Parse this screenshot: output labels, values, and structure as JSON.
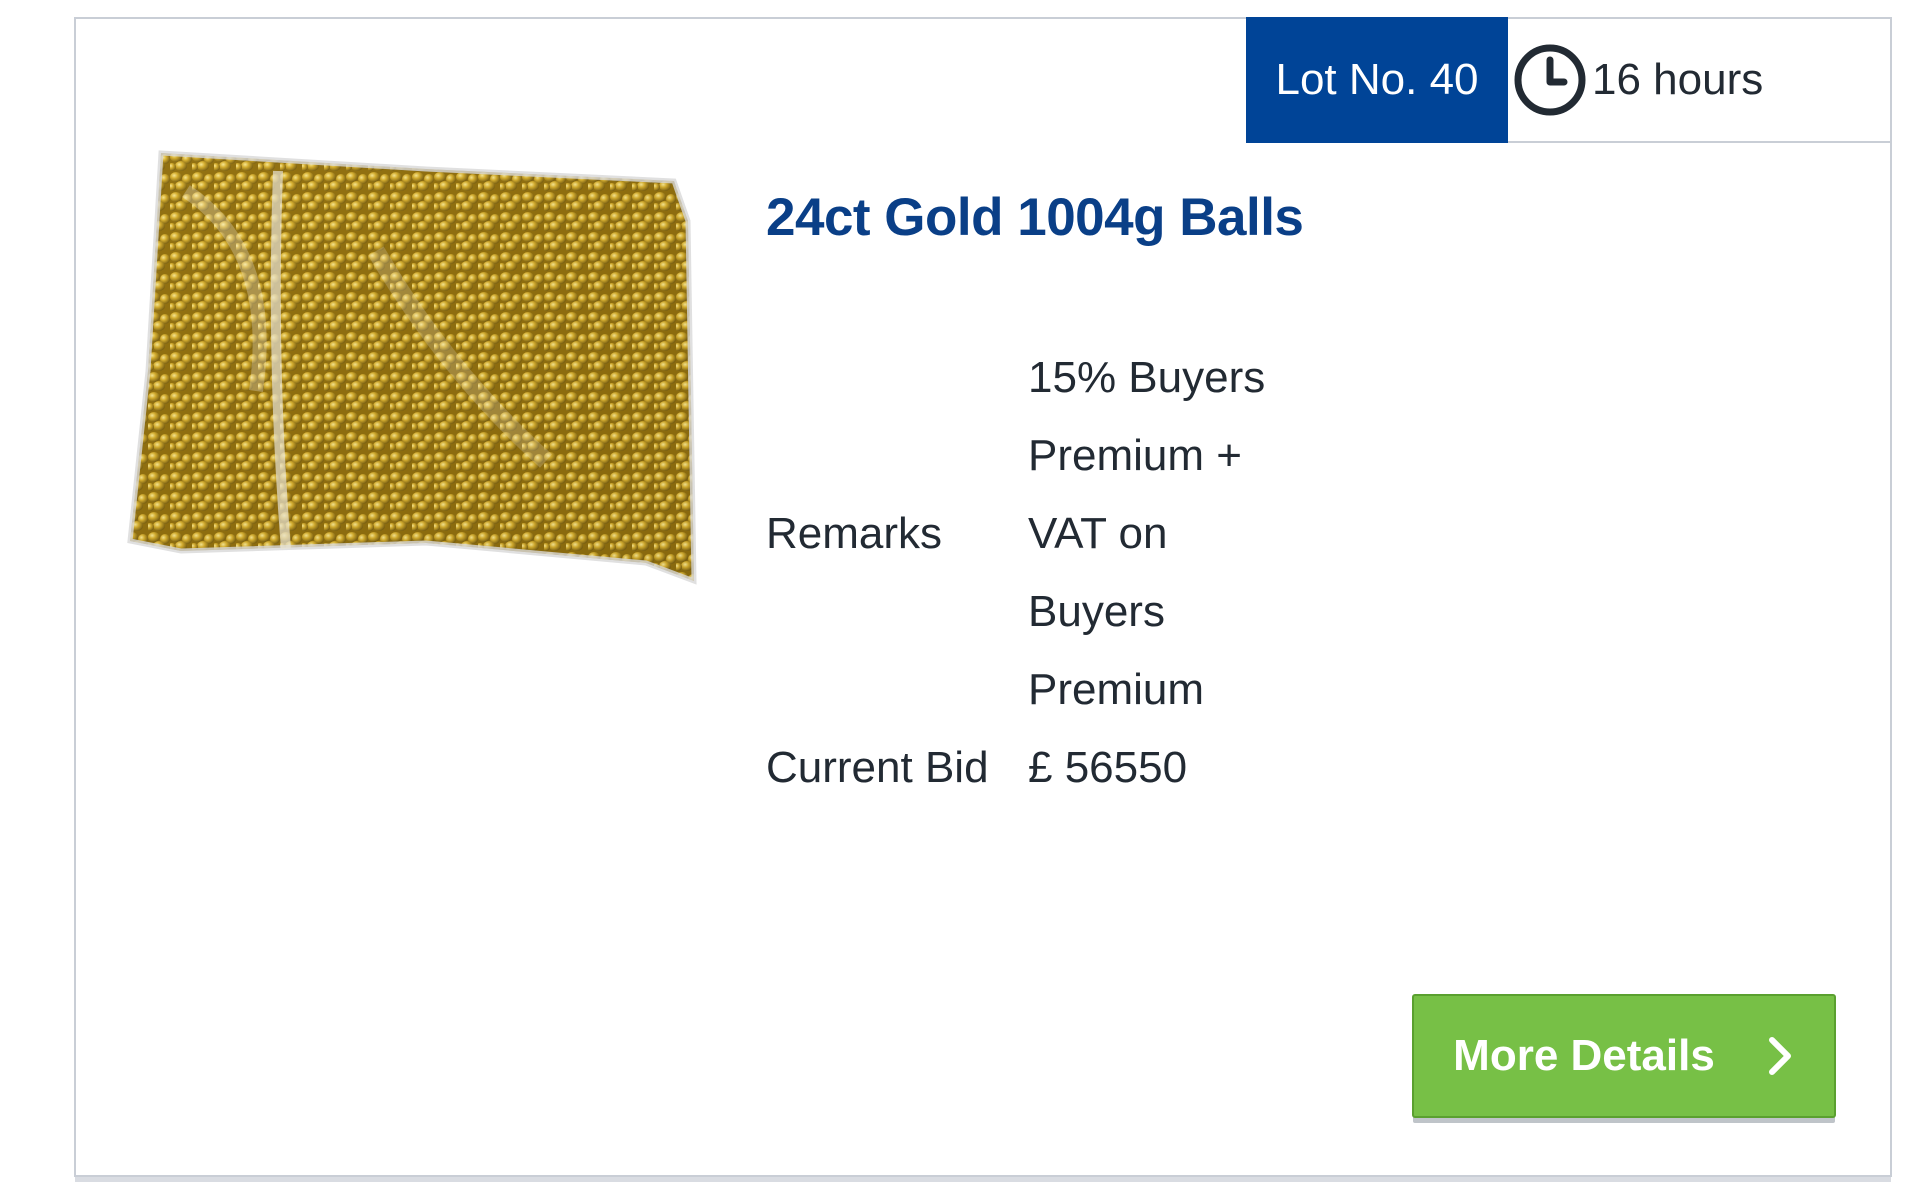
{
  "lot": {
    "label": "Lot No. 40",
    "time_remaining": "16 hours"
  },
  "item": {
    "title": "24ct Gold 1004g Balls",
    "image_alt": "Bag of gold balls",
    "image_icon": "gold-balls-bag-image"
  },
  "details": {
    "remarks_label": "Remarks",
    "remarks_value": "15% Buyers Premium + VAT on Buyers Premium",
    "current_bid_label": "Current Bid",
    "current_bid_value": "£ 56550"
  },
  "actions": {
    "more_details_label": "More Details",
    "more_details_icon": "chevron-right-icon"
  },
  "colors": {
    "brand_blue": "#004497",
    "title_blue": "#0a3f87",
    "button_green": "#77c046",
    "text_dark": "#222a33"
  }
}
